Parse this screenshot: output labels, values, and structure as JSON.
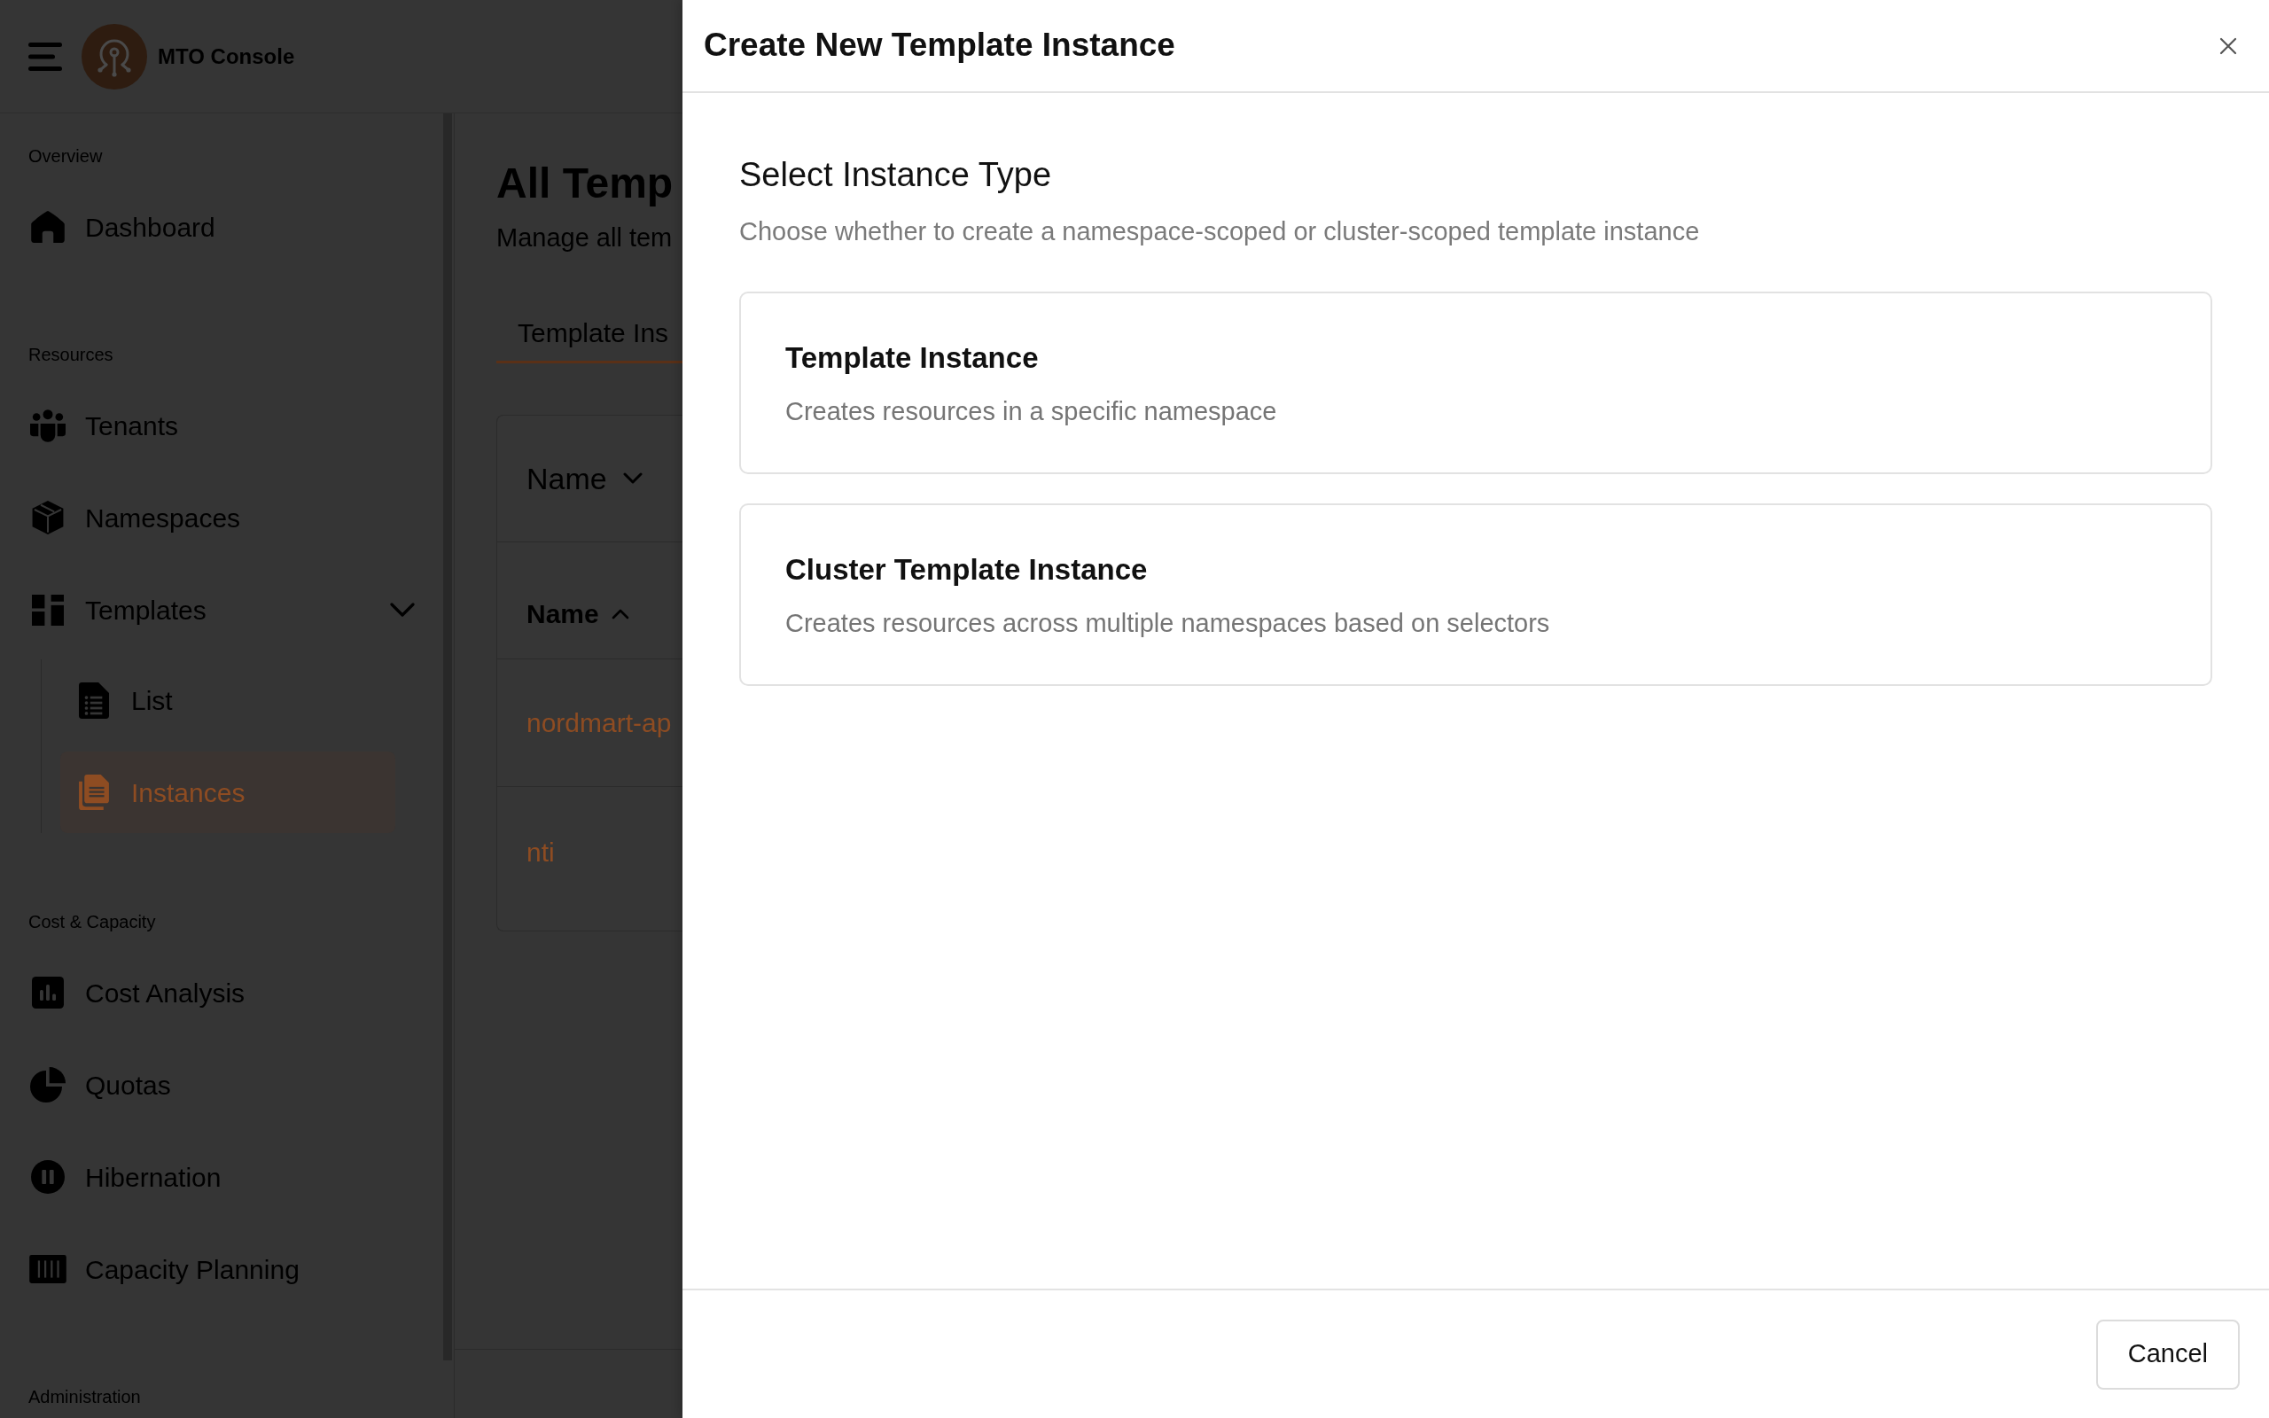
{
  "header": {
    "app_name": "MTO Console"
  },
  "sidebar": {
    "sections": [
      {
        "label": "Overview",
        "items": [
          {
            "label": "Dashboard",
            "selected": false
          }
        ]
      },
      {
        "label": "Resources",
        "items": [
          {
            "label": "Tenants",
            "selected": false
          },
          {
            "label": "Namespaces",
            "selected": false
          },
          {
            "label": "Templates",
            "selected": false,
            "expanded": true,
            "children": [
              {
                "label": "List",
                "selected": false
              },
              {
                "label": "Instances",
                "selected": true
              }
            ]
          }
        ]
      },
      {
        "label": "Cost & Capacity",
        "items": [
          {
            "label": "Cost Analysis",
            "selected": false
          },
          {
            "label": "Quotas",
            "selected": false
          },
          {
            "label": "Hibernation",
            "selected": false
          },
          {
            "label": "Capacity Planning",
            "selected": false
          }
        ]
      },
      {
        "label": "Administration"
      }
    ]
  },
  "page": {
    "title": "All Temp",
    "subtitle": "Manage all tem",
    "tabs": [
      {
        "label": "Template Ins",
        "selected": true
      }
    ],
    "table": {
      "filter": {
        "label": "Name"
      },
      "columns": [
        {
          "label": "Name",
          "sorted": true
        }
      ],
      "rows": [
        {
          "name": "nordmart-ap"
        },
        {
          "name": "nti"
        }
      ]
    }
  },
  "drawer": {
    "title": "Create New Template Instance",
    "heading": "Select Instance Type",
    "description": "Choose whether to create a namespace-scoped or cluster-scoped template instance",
    "options": [
      {
        "title": "Template Instance",
        "description": "Creates resources in a specific namespace"
      },
      {
        "title": "Cluster Template Instance",
        "description": "Creates resources across multiple namespaces based on selectors"
      }
    ],
    "buttons": [
      {
        "label": "Cancel"
      }
    ]
  }
}
